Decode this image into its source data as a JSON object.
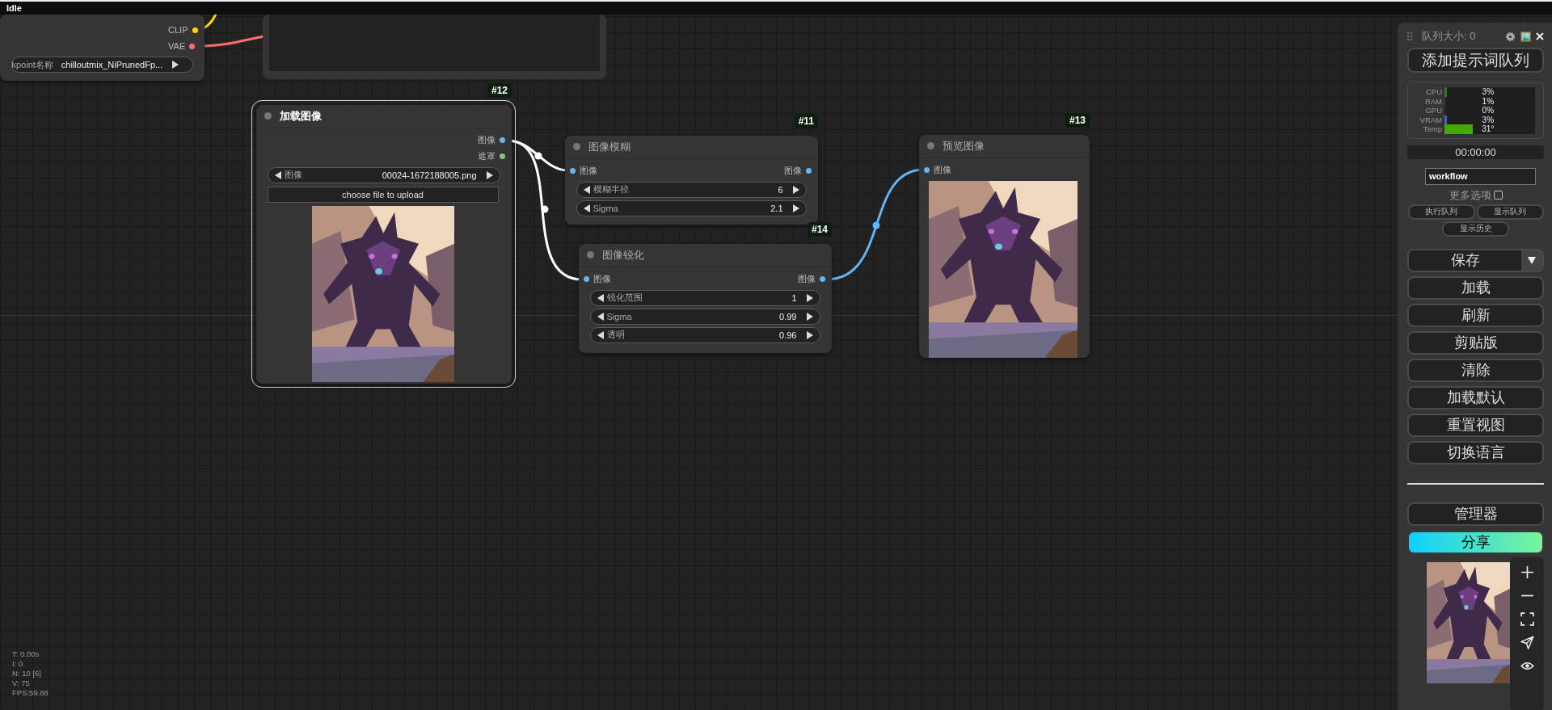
{
  "status": "Idle",
  "nodes": [
    {
      "selected": false,
      "outputs": [
        {
          "label": "CLIP",
          "color": "#ffd500"
        },
        {
          "label": "VAE",
          "color": "#ff6e6e"
        }
      ],
      "widgets": [
        {
          "label": "kpoint名称",
          "value": "chilloutmix_NiPrunedFp..."
        }
      ]
    },
    {
      "badge": "#12",
      "title": "加载图像",
      "selected": true,
      "outputs": [
        {
          "label": "图像",
          "color": "#64b5f6"
        },
        {
          "label": "遮罩",
          "color": "#81c784"
        }
      ],
      "widgets": [
        {
          "label": "图像",
          "value": "00024-1672188005.png"
        }
      ],
      "upload_button": "choose file to upload",
      "image": {
        "kind": "picture"
      }
    },
    {
      "badge": "#11",
      "title": "图像模糊",
      "selected": false,
      "inputs": [
        {
          "label": "图像",
          "color": "#64b5f6"
        }
      ],
      "outputs": [
        {
          "label": "图像",
          "color": "#64b5f6"
        }
      ],
      "widgets": [
        {
          "label": "模糊半径",
          "value": "6"
        },
        {
          "label": "Sigma",
          "value": "2.1"
        }
      ]
    },
    {
      "badge": "#14",
      "title": "图像锐化",
      "selected": false,
      "inputs": [
        {
          "label": "图像",
          "color": "#64b5f6"
        }
      ],
      "outputs": [
        {
          "label": "图像",
          "color": "#64b5f6"
        }
      ],
      "widgets": [
        {
          "label": "锐化范围",
          "value": "1"
        },
        {
          "label": "Sigma",
          "value": "0.99"
        },
        {
          "label": "透明",
          "value": "0.96"
        }
      ]
    },
    {
      "badge": "#13",
      "title": "预览图像",
      "selected": false,
      "inputs": [
        {
          "label": "图像",
          "color": "#64b5f6"
        }
      ],
      "image": {
        "kind": "picture"
      }
    }
  ],
  "panel": {
    "queue_size": "队列大小: 0",
    "queue_button": "添加提示词队列",
    "monitor": [
      {
        "label": "CPU",
        "value": "3%",
        "level": 0.03,
        "color": "#0a8a0a"
      },
      {
        "label": "RAM",
        "value": "1%",
        "level": 0.01,
        "color": "#0a5a0a"
      },
      {
        "label": "GPU",
        "value": "0%",
        "level": 0
      },
      {
        "label": "VRAM",
        "value": "3%",
        "level": 0.03,
        "color": "#1e6fd0"
      },
      {
        "label": "Temp",
        "value": "31°",
        "level": 0.31,
        "color": "#44aa00"
      }
    ],
    "timer": "00:00:00",
    "workflow_name": "workflow",
    "more_options": {
      "label": "更多选项",
      "checked": false
    },
    "queue_buttons": [
      "执行队列",
      "显示队列",
      "显示历史"
    ],
    "save_button": "保存",
    "buttons": [
      "加载",
      "刷新",
      "剪贴版",
      "清除",
      "加载默认",
      "重置视图",
      "切换语言"
    ],
    "manager_button": "管理器",
    "share_button": "分享",
    "thumbnail": {
      "kind": "picture"
    }
  },
  "stats": [
    "T: 0.00s",
    "I: 0",
    "N: 10 [6]",
    "V: 75",
    "FPS:59.88"
  ]
}
